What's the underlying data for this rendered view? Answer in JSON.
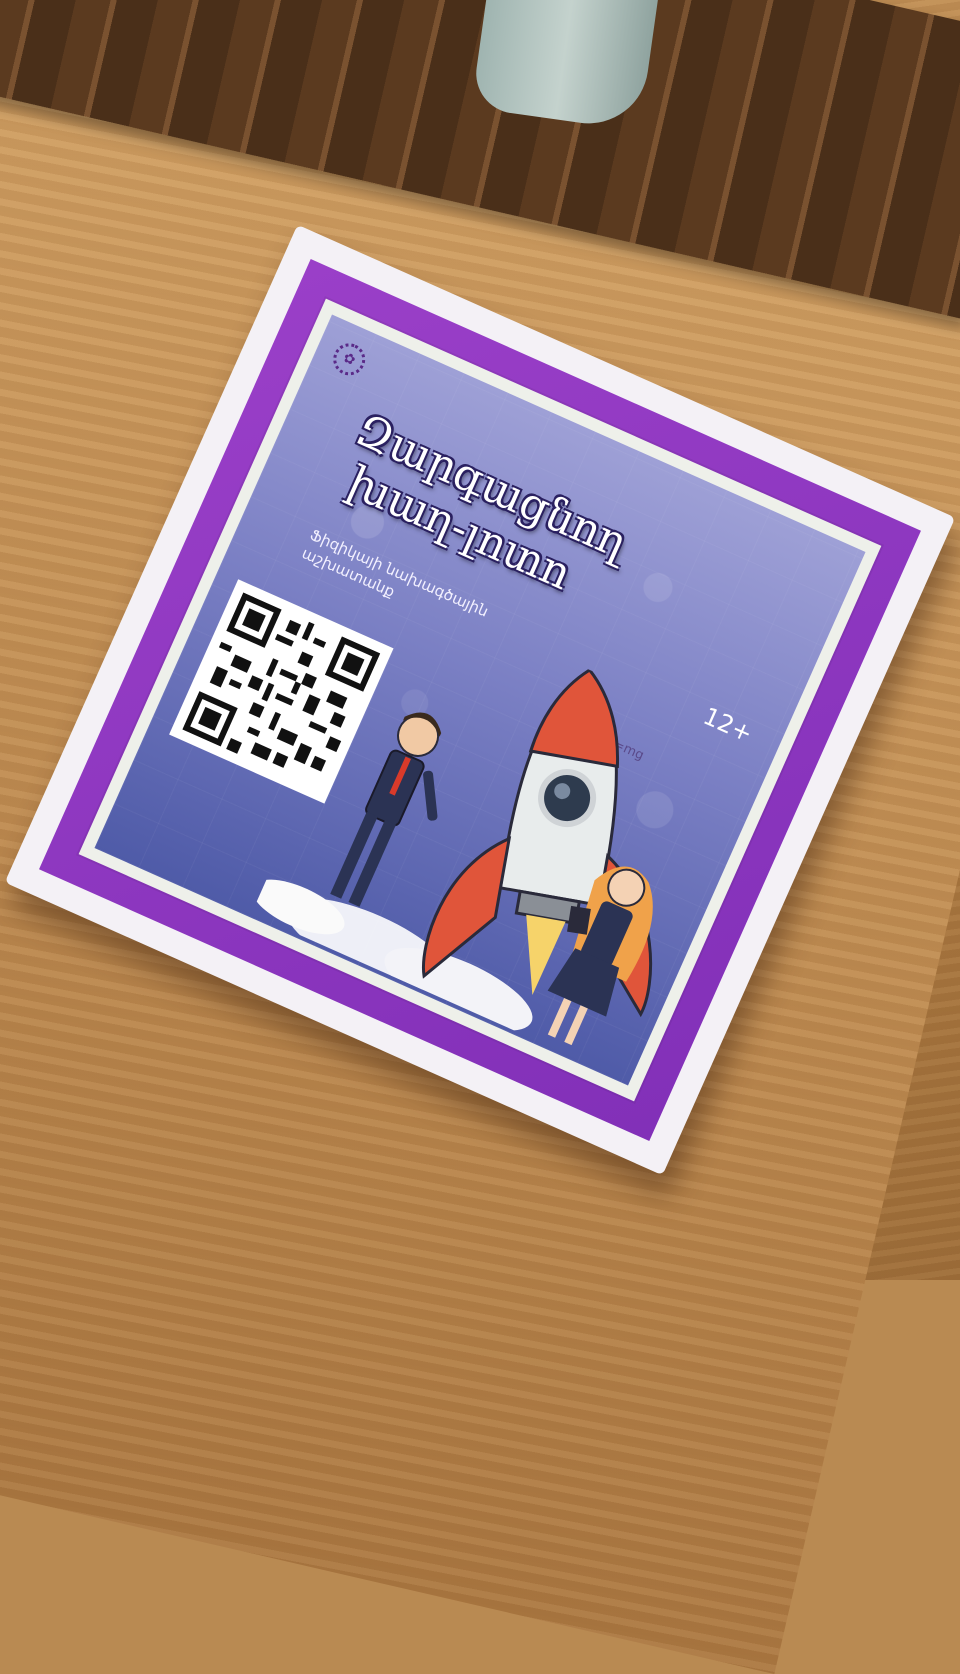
{
  "box": {
    "title_line1": "Զարգացնող",
    "title_line2": "խաղ-լոտո",
    "subtitle_line1": "Ֆիզիկայի նախագծային",
    "subtitle_line2": "աշխատանք",
    "age_rating": "12+",
    "formula": "F=mg",
    "logo_icon": "gear-icon",
    "colors": {
      "border": "#8a34bf",
      "art_top": "#9ea0d6",
      "art_bottom": "#4f5ba8",
      "rocket": "#e0553a"
    }
  }
}
